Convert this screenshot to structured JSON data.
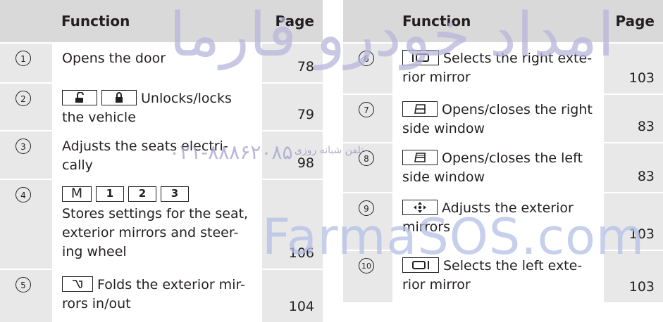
{
  "left_table": {
    "header": {
      "function": "Function",
      "page": "Page"
    },
    "rows": [
      {
        "num": "1",
        "text": "Opens the door",
        "page": "78",
        "buttons": []
      },
      {
        "num": "2",
        "text": "Unlocks/locks the vehicle",
        "page": "79",
        "buttons": [
          "unlock-icon",
          "lock-icon"
        ]
      },
      {
        "num": "3",
        "text": "Adjusts the seats electri-cally",
        "page": "98",
        "buttons": []
      },
      {
        "num": "4",
        "text": "Stores settings for the seat, exterior mirrors and steer-ing wheel",
        "page": "106",
        "buttons": [
          "M",
          "1",
          "2",
          "3"
        ]
      },
      {
        "num": "5",
        "text": "Folds the exterior mir-rors in/out",
        "page": "104",
        "buttons": [
          "mirror-fold-icon"
        ]
      }
    ]
  },
  "right_table": {
    "header": {
      "function": "Function",
      "page": "Page"
    },
    "rows": [
      {
        "num": "6",
        "text": "Selects the right exte-rior mirror",
        "page": "103",
        "buttons": [
          "right-mirror-icon"
        ]
      },
      {
        "num": "7",
        "text": "Opens/closes the right side window",
        "page": "83",
        "buttons": [
          "right-window-icon"
        ]
      },
      {
        "num": "8",
        "text": "Opens/closes the left side window",
        "page": "83",
        "buttons": [
          "left-window-icon"
        ]
      },
      {
        "num": "9",
        "text": "Adjusts the exterior mirrors",
        "page": "103",
        "buttons": [
          "mirror-adjust-icon"
        ]
      },
      {
        "num": "10",
        "text": "Selects the left exte-rior mirror",
        "page": "103",
        "buttons": [
          "left-mirror-icon"
        ]
      }
    ]
  },
  "watermark": {
    "persian": "امداد خودرو فارما",
    "phone": "۰۲۱-۸۸۸۶۲۰۸۵",
    "phone_label": "تلفن شبانه روزی",
    "brand": "FarmaSOS.com"
  }
}
